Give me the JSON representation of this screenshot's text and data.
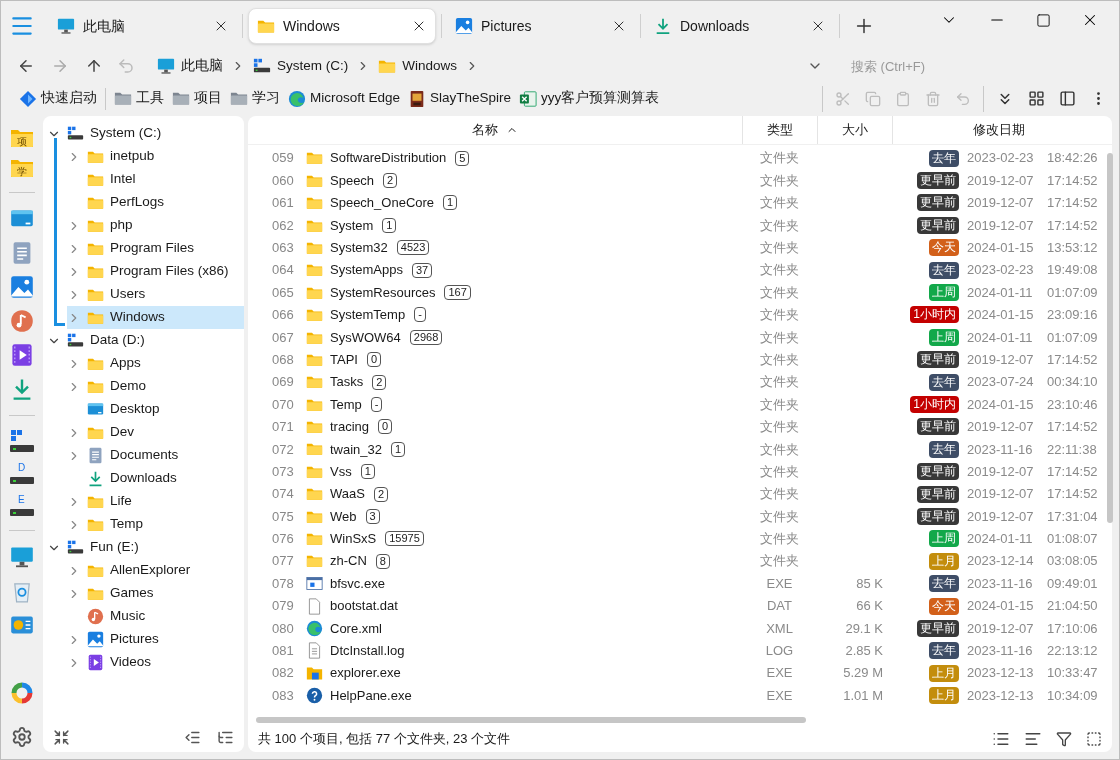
{
  "tabs": [
    {
      "label": "此电脑",
      "kind": "computer",
      "selected": false
    },
    {
      "label": "Windows",
      "kind": "folder",
      "selected": true
    },
    {
      "label": "Pictures",
      "kind": "pictures",
      "selected": false
    },
    {
      "label": "Downloads",
      "kind": "downloads",
      "selected": false
    }
  ],
  "breadcrumb": [
    {
      "label": "此电脑",
      "kind": "computer"
    },
    {
      "label": "System (C:)",
      "kind": "drive"
    },
    {
      "label": "Windows",
      "kind": "folder"
    }
  ],
  "search": {
    "placeholder": "搜索 (Ctrl+F)"
  },
  "quick_bar": [
    {
      "label": "快速启动",
      "kind": "launch"
    },
    {
      "label": "工具",
      "kind": "gray-folder"
    },
    {
      "label": "项目",
      "kind": "gray-folder"
    },
    {
      "label": "学习",
      "kind": "gray-folder"
    },
    {
      "label": "Microsoft Edge",
      "kind": "browser"
    },
    {
      "label": "SlayTheSpire",
      "kind": "game"
    },
    {
      "label": "yyy客户预算测算表",
      "kind": "sheet"
    }
  ],
  "rail": [
    {
      "kind": "folder",
      "label": "项"
    },
    {
      "kind": "folder",
      "label": "学"
    },
    {
      "kind": "divider"
    },
    {
      "kind": "desktop"
    },
    {
      "kind": "documents"
    },
    {
      "kind": "pictures"
    },
    {
      "kind": "music"
    },
    {
      "kind": "videos"
    },
    {
      "kind": "downloads"
    },
    {
      "kind": "divider"
    },
    {
      "kind": "drive"
    },
    {
      "kind": "drive",
      "label": "D"
    },
    {
      "kind": "drive",
      "label": "E"
    },
    {
      "kind": "divider"
    },
    {
      "kind": "monitor"
    },
    {
      "kind": "recycle"
    },
    {
      "kind": "control"
    }
  ],
  "tree": [
    {
      "label": "System (C:)",
      "kind": "drive",
      "expanded": true,
      "selected": false,
      "children": [
        {
          "label": "inetpub",
          "kind": "folder",
          "expanded": false,
          "selected": false
        },
        {
          "label": "Intel",
          "kind": "folder",
          "selected": false
        },
        {
          "label": "PerfLogs",
          "kind": "folder",
          "selected": false
        },
        {
          "label": "php",
          "kind": "folder",
          "expanded": false,
          "selected": false
        },
        {
          "label": "Program Files",
          "kind": "folder",
          "expanded": false,
          "selected": false
        },
        {
          "label": "Program Files (x86)",
          "kind": "folder",
          "expanded": false,
          "selected": false
        },
        {
          "label": "Users",
          "kind": "folder",
          "expanded": false,
          "selected": false
        },
        {
          "label": "Windows",
          "kind": "folder",
          "expanded": false,
          "selected": true
        }
      ]
    },
    {
      "label": "Data (D:)",
      "kind": "drive",
      "expanded": true,
      "selected": false,
      "children": [
        {
          "label": "Apps",
          "kind": "folder",
          "expanded": false,
          "selected": false
        },
        {
          "label": "Demo",
          "kind": "folder",
          "expanded": false,
          "selected": false
        },
        {
          "label": "Desktop",
          "kind": "desktop",
          "selected": false
        },
        {
          "label": "Dev",
          "kind": "folder",
          "expanded": false,
          "selected": false
        },
        {
          "label": "Documents",
          "kind": "documents",
          "expanded": false,
          "selected": false
        },
        {
          "label": "Downloads",
          "kind": "downloads",
          "selected": false
        },
        {
          "label": "Life",
          "kind": "folder",
          "expanded": false,
          "selected": false
        },
        {
          "label": "Temp",
          "kind": "folder",
          "expanded": false,
          "selected": false
        }
      ]
    },
    {
      "label": "Fun (E:)",
      "kind": "drive",
      "expanded": true,
      "selected": false,
      "children": [
        {
          "label": "AllenExplorer",
          "kind": "folder",
          "expanded": false,
          "selected": false
        },
        {
          "label": "Games",
          "kind": "folder",
          "expanded": false,
          "selected": false
        },
        {
          "label": "Music",
          "kind": "music",
          "selected": false
        },
        {
          "label": "Pictures",
          "kind": "pictures",
          "expanded": false,
          "selected": false
        },
        {
          "label": "Videos",
          "kind": "videos",
          "expanded": false,
          "selected": false
        }
      ]
    }
  ],
  "table": {
    "columns": [
      {
        "label": "名称",
        "sort_ascending": true
      },
      {
        "label": "类型"
      },
      {
        "label": "大小"
      },
      {
        "label": "修改日期"
      }
    ],
    "rows": [
      {
        "index": "059",
        "kind": "folder",
        "name": "SoftwareDistribution",
        "count": "5",
        "type": "文件夹",
        "badge": {
          "text": "去年",
          "color": "#3e4d66"
        },
        "date": "2023-02-23",
        "time": "18:42:26"
      },
      {
        "index": "060",
        "kind": "folder",
        "name": "Speech",
        "count": "2",
        "type": "文件夹",
        "badge": {
          "text": "更早前",
          "color": "#383838"
        },
        "date": "2019-12-07",
        "time": "17:14:52"
      },
      {
        "index": "061",
        "kind": "folder",
        "name": "Speech_OneCore",
        "count": "1",
        "type": "文件夹",
        "badge": {
          "text": "更早前",
          "color": "#383838"
        },
        "date": "2019-12-07",
        "time": "17:14:52"
      },
      {
        "index": "062",
        "kind": "folder",
        "name": "System",
        "count": "1",
        "type": "文件夹",
        "badge": {
          "text": "更早前",
          "color": "#383838"
        },
        "date": "2019-12-07",
        "time": "17:14:52"
      },
      {
        "index": "063",
        "kind": "folder",
        "name": "System32",
        "count": "4523",
        "type": "文件夹",
        "badge": {
          "text": "今天",
          "color": "#d2601a"
        },
        "date": "2024-01-15",
        "time": "13:53:12"
      },
      {
        "index": "064",
        "kind": "folder",
        "name": "SystemApps",
        "count": "37",
        "type": "文件夹",
        "badge": {
          "text": "去年",
          "color": "#3e4d66"
        },
        "date": "2023-02-23",
        "time": "19:49:08"
      },
      {
        "index": "065",
        "kind": "folder",
        "name": "SystemResources",
        "count": "167",
        "type": "文件夹",
        "badge": {
          "text": "上周",
          "color": "#12a84a"
        },
        "date": "2024-01-11",
        "time": "01:07:09"
      },
      {
        "index": "066",
        "kind": "folder",
        "name": "SystemTemp",
        "count": "-",
        "type": "文件夹",
        "badge": {
          "text": "1小时内",
          "color": "#c40000"
        },
        "date": "2024-01-15",
        "time": "23:09:16"
      },
      {
        "index": "067",
        "kind": "folder",
        "name": "SysWOW64",
        "count": "2968",
        "type": "文件夹",
        "badge": {
          "text": "上周",
          "color": "#12a84a"
        },
        "date": "2024-01-11",
        "time": "01:07:09"
      },
      {
        "index": "068",
        "kind": "folder",
        "name": "TAPI",
        "count": "0",
        "type": "文件夹",
        "badge": {
          "text": "更早前",
          "color": "#383838"
        },
        "date": "2019-12-07",
        "time": "17:14:52"
      },
      {
        "index": "069",
        "kind": "folder",
        "name": "Tasks",
        "count": "2",
        "type": "文件夹",
        "badge": {
          "text": "去年",
          "color": "#3e4d66"
        },
        "date": "2023-07-24",
        "time": "00:34:10"
      },
      {
        "index": "070",
        "kind": "folder",
        "name": "Temp",
        "count": "-",
        "type": "文件夹",
        "badge": {
          "text": "1小时内",
          "color": "#c40000"
        },
        "date": "2024-01-15",
        "time": "23:10:46"
      },
      {
        "index": "071",
        "kind": "folder",
        "name": "tracing",
        "count": "0",
        "type": "文件夹",
        "badge": {
          "text": "更早前",
          "color": "#383838"
        },
        "date": "2019-12-07",
        "time": "17:14:52"
      },
      {
        "index": "072",
        "kind": "folder",
        "name": "twain_32",
        "count": "1",
        "type": "文件夹",
        "badge": {
          "text": "去年",
          "color": "#3e4d66"
        },
        "date": "2023-11-16",
        "time": "22:11:38"
      },
      {
        "index": "073",
        "kind": "folder",
        "name": "Vss",
        "count": "1",
        "type": "文件夹",
        "badge": {
          "text": "更早前",
          "color": "#383838"
        },
        "date": "2019-12-07",
        "time": "17:14:52"
      },
      {
        "index": "074",
        "kind": "folder",
        "name": "WaaS",
        "count": "2",
        "type": "文件夹",
        "badge": {
          "text": "更早前",
          "color": "#383838"
        },
        "date": "2019-12-07",
        "time": "17:14:52"
      },
      {
        "index": "075",
        "kind": "folder",
        "name": "Web",
        "count": "3",
        "type": "文件夹",
        "badge": {
          "text": "更早前",
          "color": "#383838"
        },
        "date": "2019-12-07",
        "time": "17:31:04"
      },
      {
        "index": "076",
        "kind": "folder",
        "name": "WinSxS",
        "count": "15975",
        "type": "文件夹",
        "badge": {
          "text": "上周",
          "color": "#12a84a"
        },
        "date": "2024-01-11",
        "time": "01:08:07"
      },
      {
        "index": "077",
        "kind": "folder",
        "name": "zh-CN",
        "count": "8",
        "type": "文件夹",
        "badge": {
          "text": "上月",
          "color": "#c38d0c"
        },
        "date": "2023-12-14",
        "time": "03:08:05"
      },
      {
        "index": "078",
        "kind": "app",
        "name": "bfsvc.exe",
        "type": "EXE",
        "size": "85 K",
        "badge": {
          "text": "去年",
          "color": "#3e4d66"
        },
        "date": "2023-11-16",
        "time": "09:49:01"
      },
      {
        "index": "079",
        "kind": "blank",
        "name": "bootstat.dat",
        "type": "DAT",
        "size": "66 K",
        "badge": {
          "text": "今天",
          "color": "#d2601a"
        },
        "date": "2024-01-15",
        "time": "21:04:50"
      },
      {
        "index": "080",
        "kind": "browser",
        "name": "Core.xml",
        "type": "XML",
        "size": "29.1 K",
        "badge": {
          "text": "更早前",
          "color": "#383838"
        },
        "date": "2019-12-07",
        "time": "17:10:06"
      },
      {
        "index": "081",
        "kind": "text",
        "name": "DtcInstall.log",
        "type": "LOG",
        "size": "2.85 K",
        "badge": {
          "text": "去年",
          "color": "#3e4d66"
        },
        "date": "2023-11-16",
        "time": "22:13:12"
      },
      {
        "index": "082",
        "kind": "explorer",
        "name": "explorer.exe",
        "type": "EXE",
        "size": "5.29 M",
        "badge": {
          "text": "上月",
          "color": "#c38d0c"
        },
        "date": "2023-12-13",
        "time": "10:33:47"
      },
      {
        "index": "083",
        "kind": "help",
        "name": "HelpPane.exe",
        "type": "EXE",
        "size": "1.01 M",
        "badge": {
          "text": "上月",
          "color": "#c38d0c"
        },
        "date": "2023-12-13",
        "time": "10:34:09"
      }
    ]
  },
  "status_bar": {
    "text": "共 100 个项目, 包括 77 个文件夹, 23 个文件"
  }
}
